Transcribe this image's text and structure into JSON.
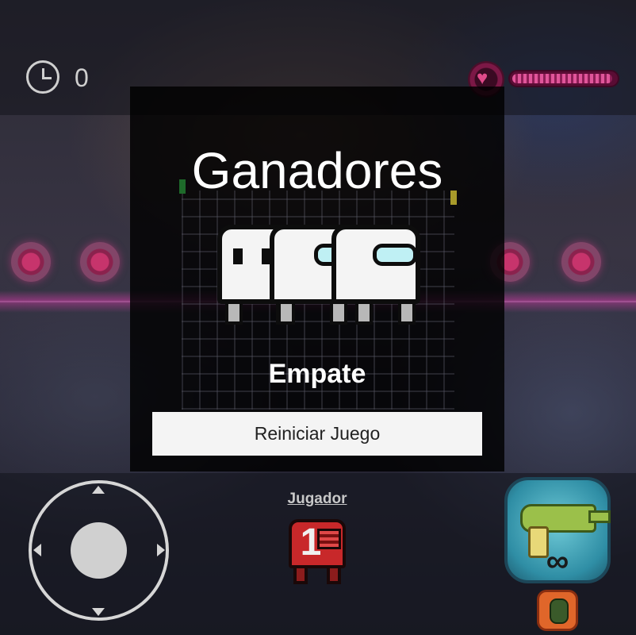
{
  "hud": {
    "timer_icon": "clock-icon",
    "timer_value": "0",
    "health_icon": "heart-icon",
    "health_level": 0.97,
    "accent_health": "#e0559a"
  },
  "overlay": {
    "title": "Ganadores",
    "winners_icon": "crewmate-ghost-icon",
    "winners_count": 3,
    "result": "Empate",
    "restart_button": "Reiniciar Juego"
  },
  "controls": {
    "joystick_icon": "joystick-icon",
    "player_label": "Jugador",
    "player_number": "1",
    "player_color": "#c8282a",
    "weapon_icon": "ray-gun-icon",
    "ammo": "∞",
    "grenade_icon": "grenade-icon"
  }
}
